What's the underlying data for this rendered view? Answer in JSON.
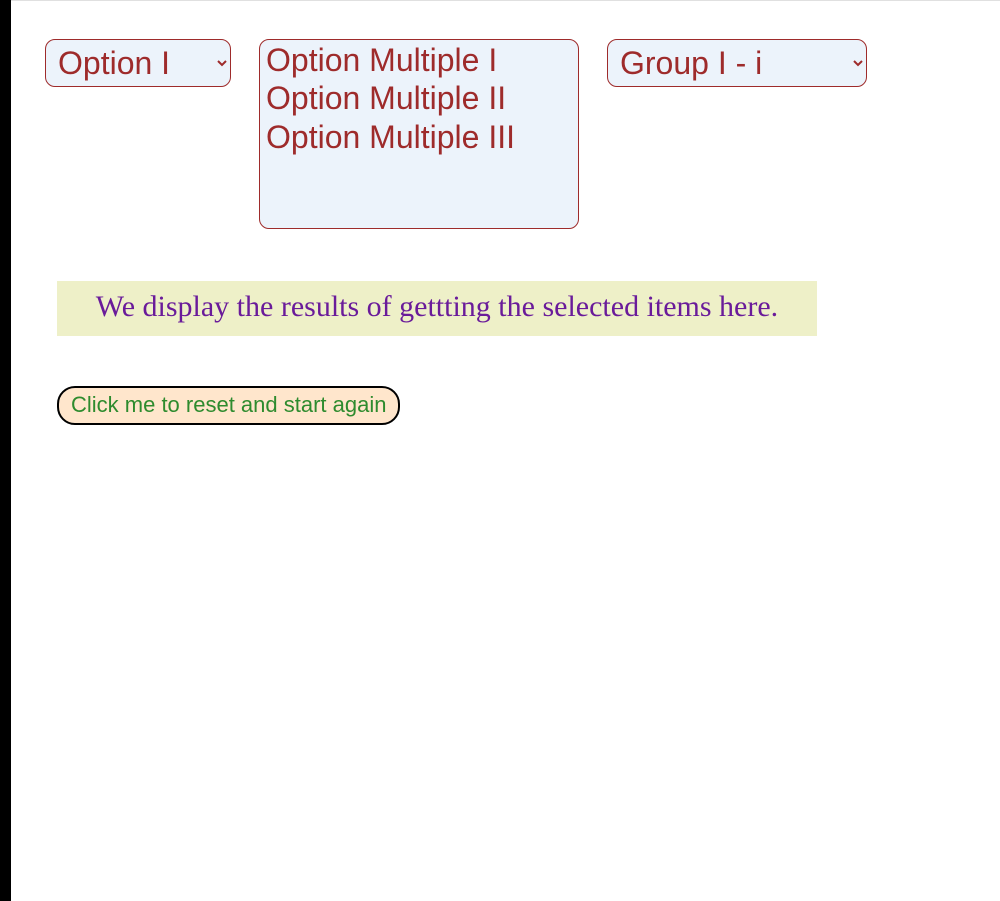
{
  "selects": {
    "single": {
      "selected": "Option I",
      "options": [
        "Option I"
      ]
    },
    "multiple": {
      "options": [
        "Option Multiple I",
        "Option Multiple II",
        "Option Multiple III"
      ]
    },
    "group": {
      "selected": "Group I - i",
      "options": [
        "Group I - i"
      ]
    }
  },
  "results_text": "We display the results of gettting the selected items here.",
  "reset_button_label": "Click me to reset and start again"
}
